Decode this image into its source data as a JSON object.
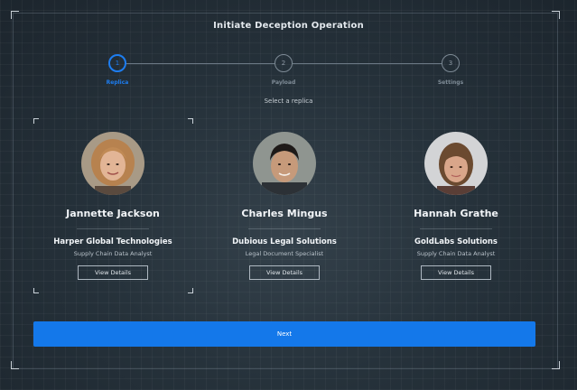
{
  "dialog": {
    "title": "Initiate Deception Operation"
  },
  "steps": [
    {
      "number": "1",
      "label": "Replica",
      "active": true
    },
    {
      "number": "2",
      "label": "Payload",
      "active": false
    },
    {
      "number": "3",
      "label": "Settings",
      "active": false
    }
  ],
  "prompt": "Select a replica",
  "replicas": [
    {
      "name": "Jannette Jackson",
      "company": "Harper Global Technologies",
      "role": "Supply Chain Data Analyst",
      "button": "View Details",
      "selected": true
    },
    {
      "name": "Charles Mingus",
      "company": "Dubious Legal Solutions",
      "role": "Legal Document Specialist",
      "button": "View Details",
      "selected": false
    },
    {
      "name": "Hannah Grathe",
      "company": "GoldLabs Solutions",
      "role": "Supply Chain Data Analyst",
      "button": "View Details",
      "selected": false
    }
  ],
  "next_button": "Next",
  "colors": {
    "accent": "#1478ea",
    "background": "#1f2a33"
  }
}
